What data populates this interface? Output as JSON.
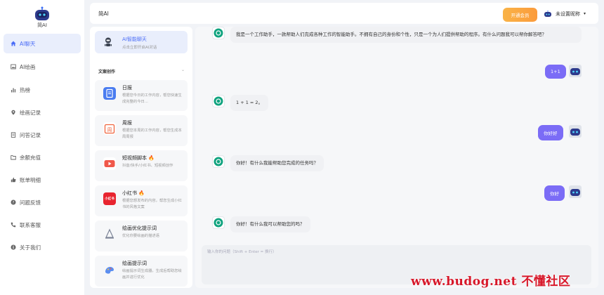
{
  "app": {
    "name": "简AI"
  },
  "nav": {
    "items": [
      {
        "label": "AI聊天",
        "icon": "home-icon",
        "active": true
      },
      {
        "label": "AI绘画",
        "icon": "image-icon"
      },
      {
        "label": "热榜",
        "icon": "bar-chart-icon"
      },
      {
        "label": "绘画记录",
        "icon": "pin-icon"
      },
      {
        "label": "问答记录",
        "icon": "document-icon"
      },
      {
        "label": "余额充值",
        "icon": "folder-icon"
      },
      {
        "label": "账单明细",
        "icon": "thumb-icon"
      },
      {
        "label": "问题反馈",
        "icon": "help-icon"
      },
      {
        "label": "联系客服",
        "icon": "phone-icon"
      },
      {
        "label": "关于我们",
        "icon": "info-icon"
      }
    ]
  },
  "header": {
    "title": "简AI",
    "vip_label": "开通会员",
    "user_name": "未设置昵称",
    "caret": "▾"
  },
  "apps": {
    "chat_entry": {
      "title": "AI智能聊天",
      "subtitle": "点击立即开启AI对话"
    },
    "category": "文案创作",
    "cards": [
      {
        "title": "日报",
        "desc": "根据您今日的工作内容，帮您快速生成完整的今日...",
        "icon_color": "#4a7cf0",
        "icon": "report-icon"
      },
      {
        "title": "周报",
        "desc": "根据您本周的工作内容，帮您生成本周周报",
        "icon_color": "#f0653f",
        "icon": "calendar-icon"
      },
      {
        "title": "短视频脚本 🔥",
        "desc": "抖音/快手/小红书、短视频创作",
        "icon_color": "#f0584a",
        "icon": "video-icon"
      },
      {
        "title": "小红书 🔥",
        "desc": "根据您想发布的内容，帮您生成小红书的风格文案",
        "icon_color": "#e8242f",
        "icon": "xiaohongshu-icon",
        "icon_text": "小红书"
      },
      {
        "title": "绘画优化提示词",
        "desc": "优化你要绘画的描述语",
        "icon_color": "#9aa3b5",
        "icon": "drafting-icon"
      },
      {
        "title": "绘画提示词",
        "desc": "绘画提示词生成器，生成后帮助您绘画并进行优化",
        "icon_color": "#5b8ef0",
        "icon": "paint-icon"
      }
    ]
  },
  "chat": {
    "messages": [
      {
        "role": "bot",
        "text": "我是一个工作助手，一款帮助人们完成各种工作的智能助手。不拥有自己的身份和个性，只是一个为人们提供帮助的程序。有什么问题我可以帮你解答吧？"
      },
      {
        "role": "user",
        "text": "1+1"
      },
      {
        "role": "bot",
        "text": "1 + 1 = 2。"
      },
      {
        "role": "user",
        "text": "你好好"
      },
      {
        "role": "bot",
        "text": "你好！有什么我能帮助您完成的任务吗？"
      },
      {
        "role": "user",
        "text": "你好"
      },
      {
        "role": "bot",
        "text": "你好！有什么我可以帮助您的吗？"
      }
    ],
    "input_placeholder": "输入你的问题（Shift + Enter = 换行）"
  },
  "watermark": "www.budog.net 不懂社区",
  "colors": {
    "accent": "#4a6cf7",
    "user_bubble": "#7b6cf6",
    "vip": "#fba842",
    "watermark": "#d7182a"
  }
}
